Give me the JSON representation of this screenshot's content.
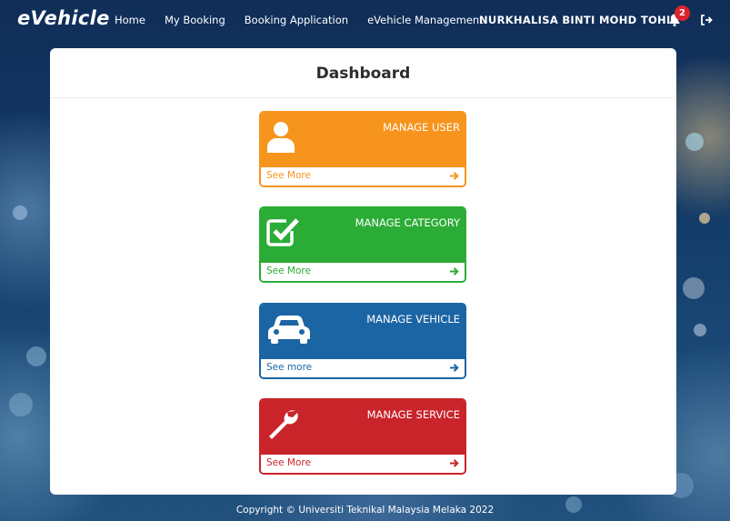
{
  "navbar": {
    "brand": "eVehicle",
    "links": [
      "Home",
      "My Booking",
      "Booking Application",
      "eVehicle Management"
    ],
    "user_name": "NURKHALISA BINTI MOHD TOHIR",
    "notification_count": "2"
  },
  "dashboard": {
    "title": "Dashboard",
    "tiles": [
      {
        "title": "MANAGE USER",
        "link_text": "See More",
        "color": "#f7941d",
        "icon": "user-icon"
      },
      {
        "title": "MANAGE CATEGORY",
        "link_text": "See More",
        "color": "#2bac36",
        "icon": "checkbox-checked-icon"
      },
      {
        "title": "MANAGE VEHICLE",
        "link_text": "See more",
        "color": "#1c65a4",
        "icon": "car-icon"
      },
      {
        "title": "MANAGE SERVICE",
        "link_text": "See More",
        "color": "#c9242a",
        "icon": "wrench-icon"
      }
    ]
  },
  "footer": {
    "copyright": "Copyright © Universiti Teknikal Malaysia Melaka 2022"
  }
}
